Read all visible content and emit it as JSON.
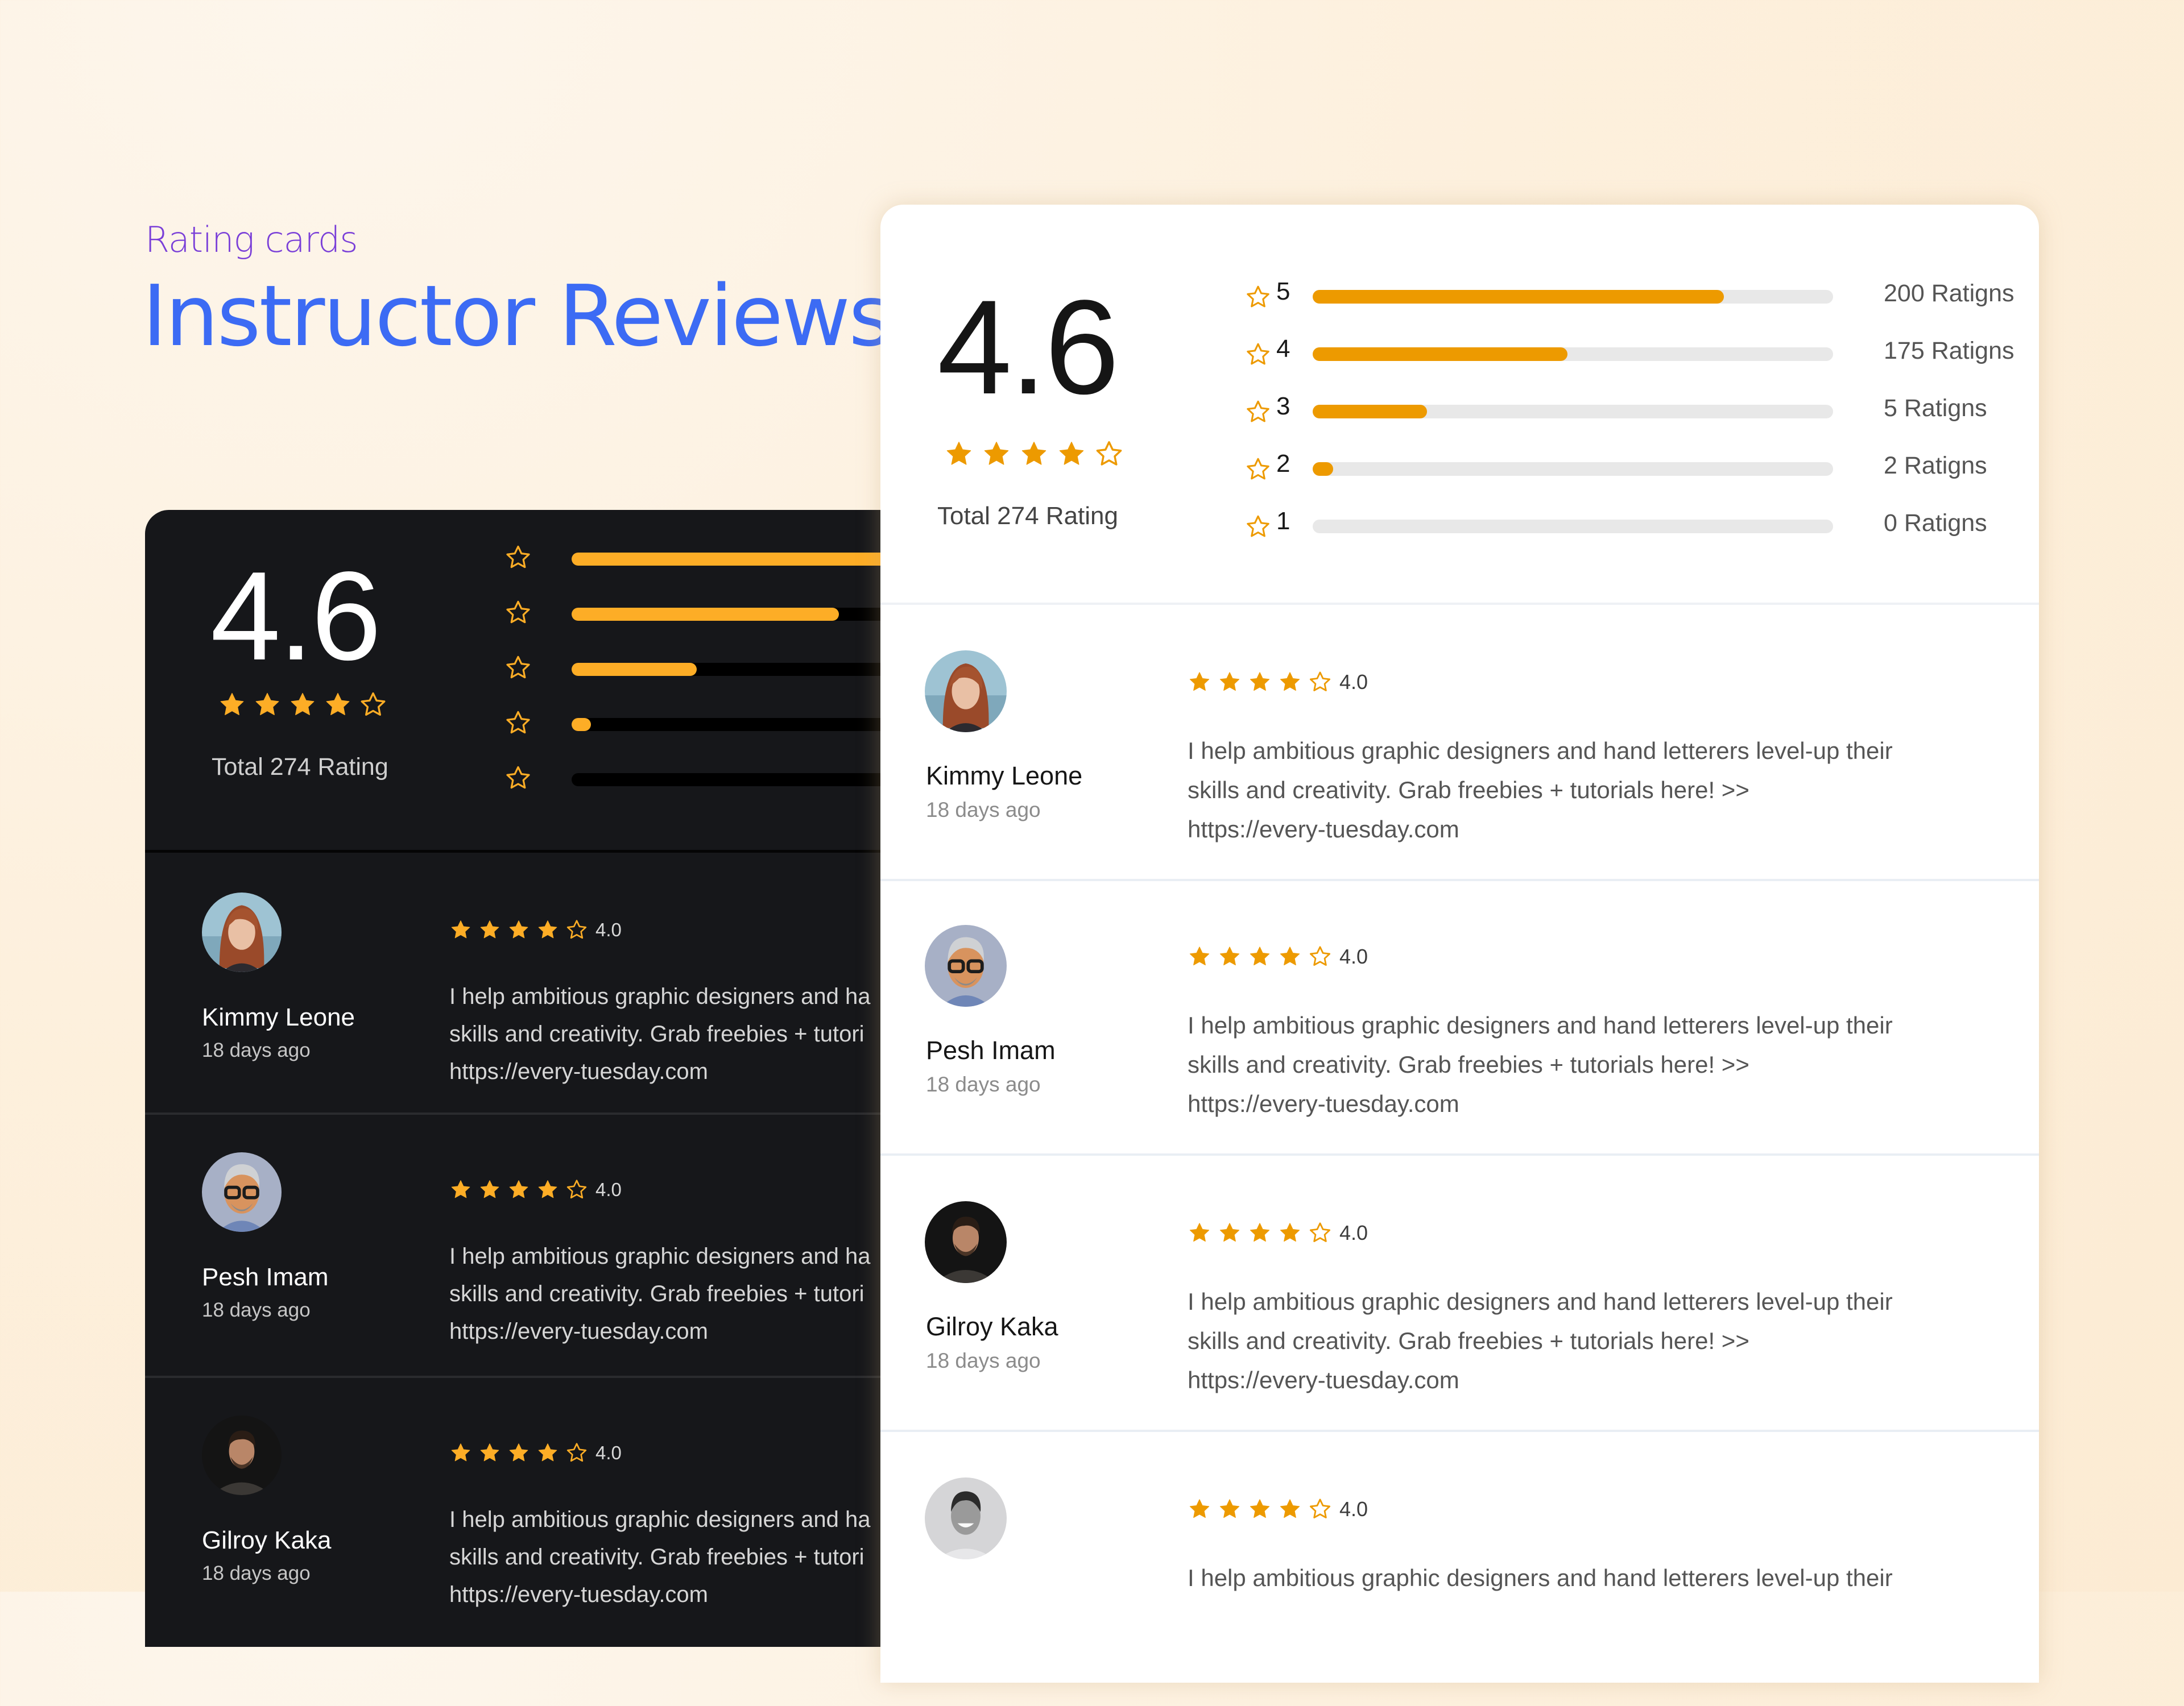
{
  "header": {
    "eyebrow": "Rating cards",
    "title": "Instructor Reviews"
  },
  "colors": {
    "eyebrow": "#7a3fd8",
    "title": "#3c6bf4",
    "star_light_theme": "#ed9a00",
    "star_dark_theme": "#fdad26",
    "dark_card_bg": "#16171a",
    "light_card_bg": "#ffffff"
  },
  "dark_card": {
    "score": "4.6",
    "stars_filled": 4,
    "stars_total": 5,
    "total_label": "Total 274 Rating",
    "distribution": [
      {
        "stars": 5,
        "fraction": 0.8
      },
      {
        "stars": 4,
        "fraction": 0.47
      },
      {
        "stars": 3,
        "fraction": 0.22
      },
      {
        "stars": 2,
        "fraction": 0.04
      },
      {
        "stars": 1,
        "fraction": 0.0
      }
    ],
    "reviews": [
      {
        "name": "Kimmy Leone",
        "ago": "18 days ago",
        "rating": "4.0",
        "stars_filled": 4,
        "avatar": "woman-red-hair",
        "lines": [
          "I help ambitious graphic designers and ha",
          "skills and creativity. Grab freebies + tutori",
          "https://every-tuesday.com"
        ]
      },
      {
        "name": "Pesh Imam",
        "ago": "18 days ago",
        "rating": "4.0",
        "stars_filled": 4,
        "avatar": "cartoon-man-glasses",
        "lines": [
          "I help ambitious graphic designers and ha",
          "skills and creativity. Grab freebies + tutori",
          "https://every-tuesday.com"
        ]
      },
      {
        "name": "Gilroy Kaka",
        "ago": "18 days ago",
        "rating": "4.0",
        "stars_filled": 4,
        "avatar": "man-dark-sweater",
        "lines": [
          "I help ambitious graphic designers and ha",
          "skills and creativity. Grab freebies + tutori",
          "https://every-tuesday.com"
        ]
      }
    ]
  },
  "light_card": {
    "score": "4.6",
    "stars_filled": 4,
    "stars_total": 5,
    "total_label": "Total 274 Rating",
    "distribution": [
      {
        "stars": 5,
        "label": "5",
        "count_label": "200 Ratigns",
        "fraction": 0.79
      },
      {
        "stars": 4,
        "label": "4",
        "count_label": "175 Ratigns",
        "fraction": 0.49
      },
      {
        "stars": 3,
        "label": "3",
        "count_label": "5 Ratigns",
        "fraction": 0.22
      },
      {
        "stars": 2,
        "label": "2",
        "count_label": "2 Ratigns",
        "fraction": 0.04
      },
      {
        "stars": 1,
        "label": "1",
        "count_label": "0 Ratigns",
        "fraction": 0.0
      }
    ],
    "reviews": [
      {
        "name": "Kimmy Leone",
        "ago": "18 days ago",
        "rating": "4.0",
        "stars_filled": 4,
        "avatar": "woman-red-hair",
        "lines": [
          "I help ambitious graphic designers and hand letterers level-up their",
          "skills and creativity. Grab freebies + tutorials here! >>",
          "https://every-tuesday.com"
        ]
      },
      {
        "name": "Pesh Imam",
        "ago": "18 days ago",
        "rating": "4.0",
        "stars_filled": 4,
        "avatar": "cartoon-man-glasses",
        "lines": [
          "I help ambitious graphic designers and hand letterers level-up their",
          "skills and creativity. Grab freebies + tutorials here! >>",
          "https://every-tuesday.com"
        ]
      },
      {
        "name": "Gilroy Kaka",
        "ago": "18 days ago",
        "rating": "4.0",
        "stars_filled": 4,
        "avatar": "man-dark-sweater",
        "lines": [
          "I help ambitious graphic designers and hand letterers level-up their",
          "skills and creativity. Grab freebies + tutorials here! >>",
          "https://every-tuesday.com"
        ]
      },
      {
        "name": "",
        "ago": "",
        "rating": "4.0",
        "stars_filled": 4,
        "avatar": "man-smiling-grayscale",
        "lines": [
          "I help ambitious graphic designers and hand letterers level-up their"
        ]
      }
    ]
  }
}
